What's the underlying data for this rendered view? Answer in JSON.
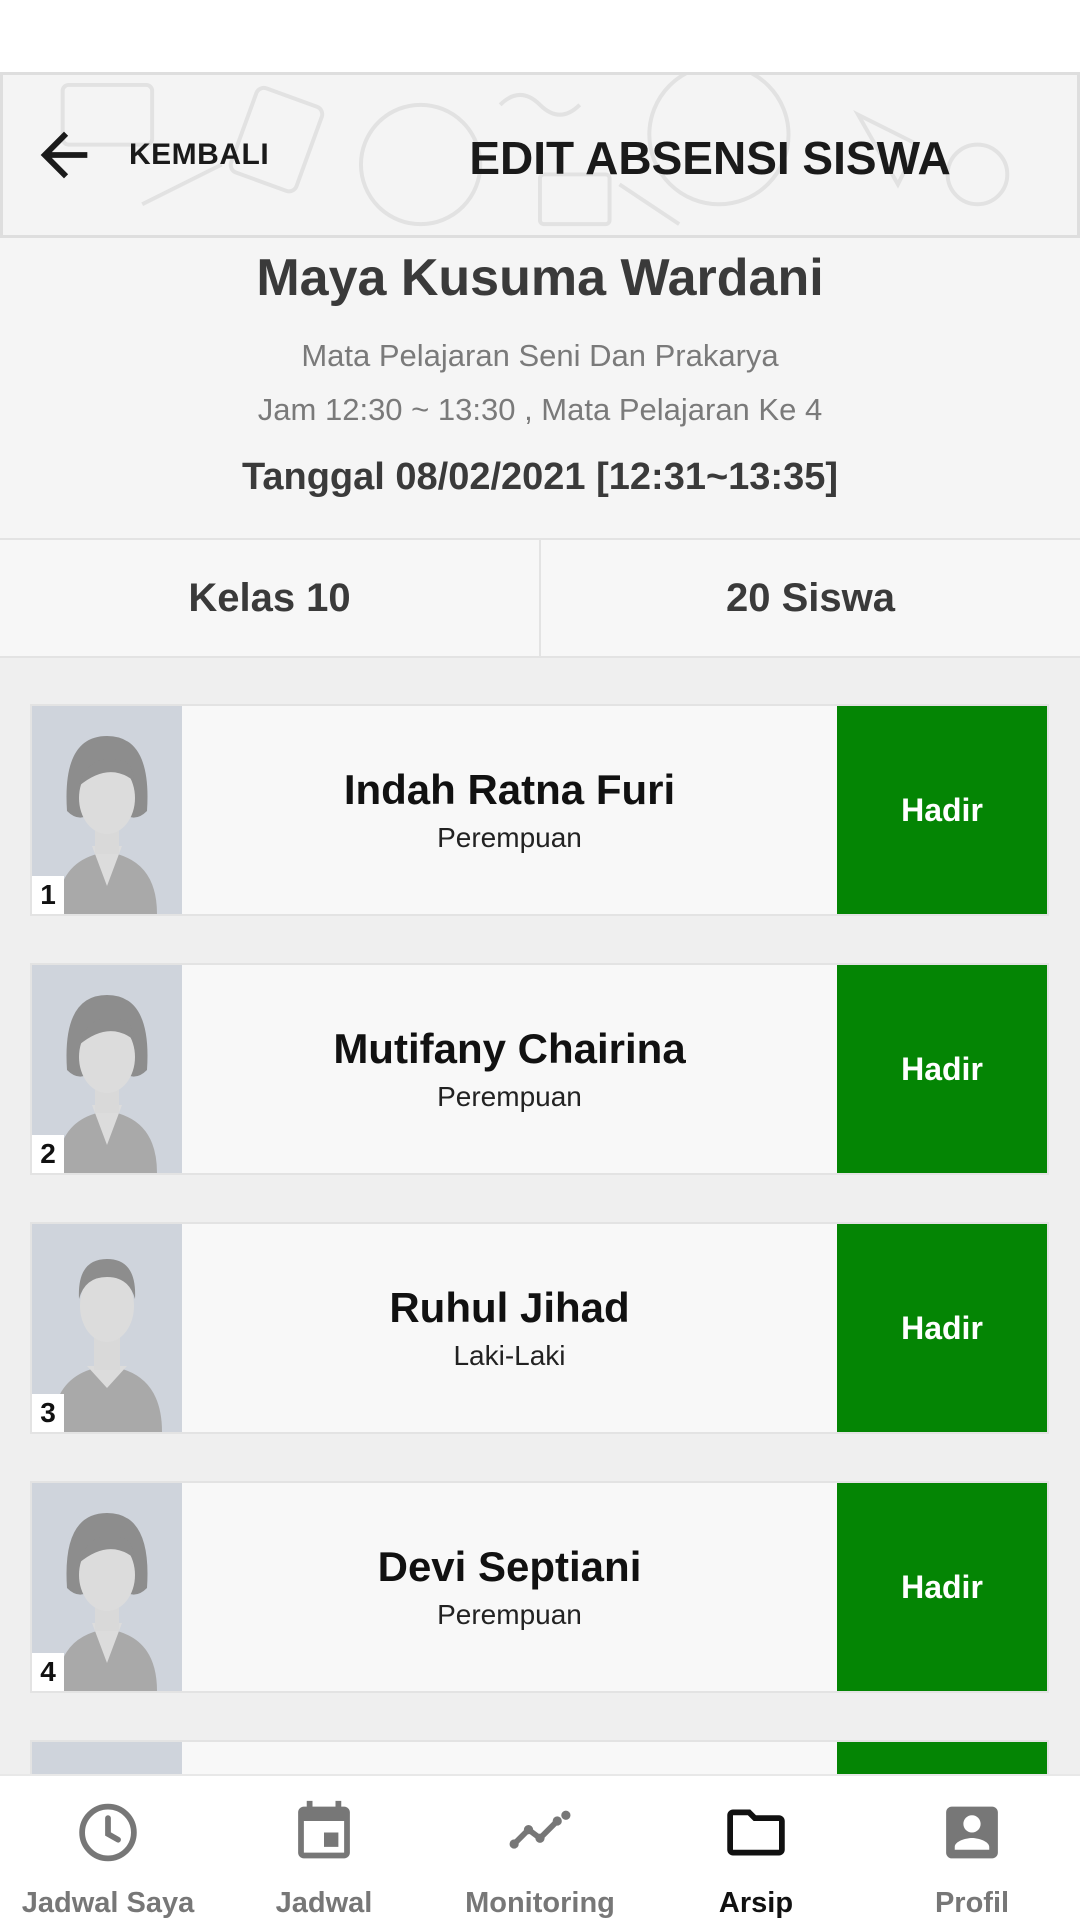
{
  "header": {
    "back_label": "KEMBALI",
    "title": "EDIT ABSENSI SISWA"
  },
  "info": {
    "teacher_name": "Maya Kusuma Wardani",
    "subject": "Mata Pelajaran Seni Dan Prakarya",
    "time": "Jam 12:30 ~ 13:30 , Mata Pelajaran Ke 4",
    "date": "Tanggal 08/02/2021 [12:31~13:35]"
  },
  "stats": {
    "class": "Kelas 10",
    "students": "20 Siswa"
  },
  "students": [
    {
      "number": "1",
      "name": "Indah Ratna Furi",
      "gender": "Perempuan",
      "status": "Hadir",
      "avatar": "female-avatar"
    },
    {
      "number": "2",
      "name": "Mutifany Chairina",
      "gender": "Perempuan",
      "status": "Hadir",
      "avatar": "female-avatar"
    },
    {
      "number": "3",
      "name": "Ruhul Jihad",
      "gender": "Laki-Laki",
      "status": "Hadir",
      "avatar": "male-avatar"
    },
    {
      "number": "4",
      "name": "Devi Septiani",
      "gender": "Perempuan",
      "status": "Hadir",
      "avatar": "female-avatar"
    }
  ],
  "nav": {
    "items": [
      {
        "label": "Jadwal Saya",
        "icon": "clock-icon"
      },
      {
        "label": "Jadwal",
        "icon": "calendar-icon"
      },
      {
        "label": "Monitoring",
        "icon": "trend-icon"
      },
      {
        "label": "Arsip",
        "icon": "folder-icon",
        "active": true
      },
      {
        "label": "Profil",
        "icon": "account-box-icon"
      }
    ]
  },
  "colors": {
    "status_present": "#048504",
    "nav_active": "#111111",
    "nav_inactive": "#777777"
  }
}
